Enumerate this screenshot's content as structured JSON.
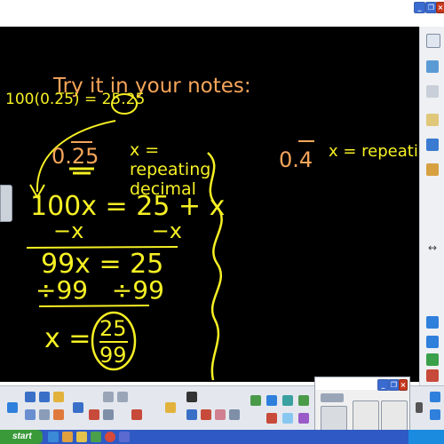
{
  "canvas": {
    "title": "Try it  in your notes:",
    "left_work": {
      "top_note": "100(0.2̅5̅) = 25.25",
      "x_def": "x = repeating decimal",
      "decimal": "0.25",
      "eq1": "100x = 25 + x",
      "eq1_sub": "−x          −x",
      "eq2": "99x = 25",
      "eq2_div": "÷99   ÷99",
      "result_lhs": "x =",
      "result_num": "25",
      "result_den": "99"
    },
    "right_work": {
      "decimal": "0.4",
      "x_def": "x = repeating"
    }
  },
  "toolbar": {
    "pen_tools": "pens",
    "color_picker": "colors"
  },
  "taskbar": {
    "start_label": "start"
  },
  "colors": {
    "board": "#000000",
    "yellow_ink": "#f6f024",
    "orange_ink": "#f6a55a",
    "taskbar": "#2f59c4"
  }
}
